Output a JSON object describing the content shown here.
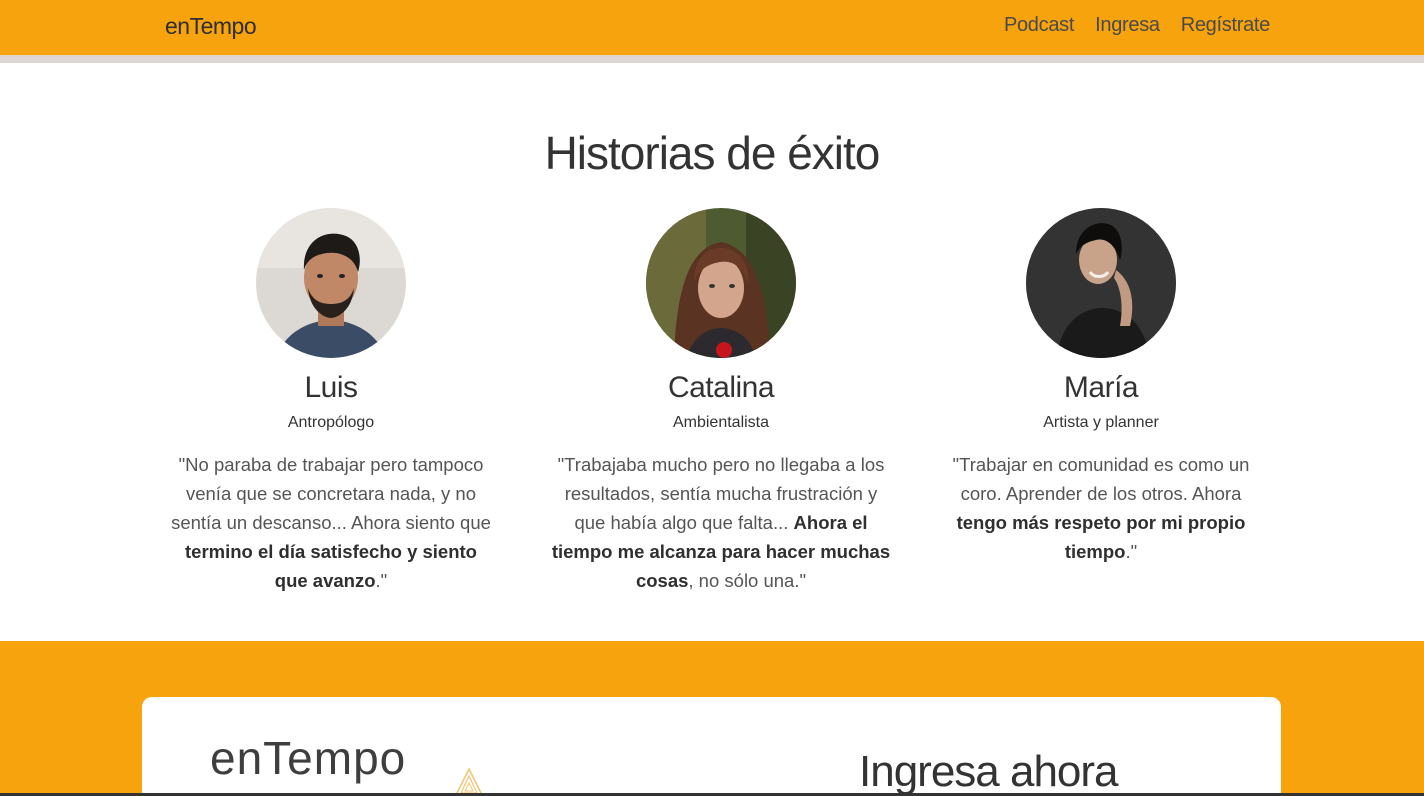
{
  "navbar": {
    "brand": "enTempo",
    "links": [
      "Podcast",
      "Ingresa",
      "Regístrate"
    ]
  },
  "section": {
    "title": "Historias de éxito"
  },
  "testimonials": [
    {
      "name": "Luis",
      "role": "Antropólogo",
      "quote_plain": "\"No paraba de trabajar pero tampoco venía que se concretara nada, y no sentía un descanso... Ahora siento que ",
      "quote_bold": "termino el día satisfecho y siento que avanzo",
      "quote_end": ".\""
    },
    {
      "name": "Catalina",
      "role": "Ambientalista",
      "quote_plain": "\"Trabajaba mucho pero no llegaba a los resultados, sentía mucha frustración y que había algo que falta... ",
      "quote_bold": "Ahora el tiempo me alcanza para hacer muchas cosas",
      "quote_end": ", no sólo una.\""
    },
    {
      "name": "María",
      "role": "Artista y planner",
      "quote_plain": "\"Trabajar en comunidad es como un coro. Aprender de los otros. Ahora ",
      "quote_bold": "tengo más respeto por mi propio tiempo",
      "quote_end": ".\""
    }
  ],
  "login": {
    "logo_text": "enTempo",
    "title": "Ingresa ahora"
  },
  "colors": {
    "accent": "#f7a30e",
    "divider": "#ddd6d4"
  }
}
